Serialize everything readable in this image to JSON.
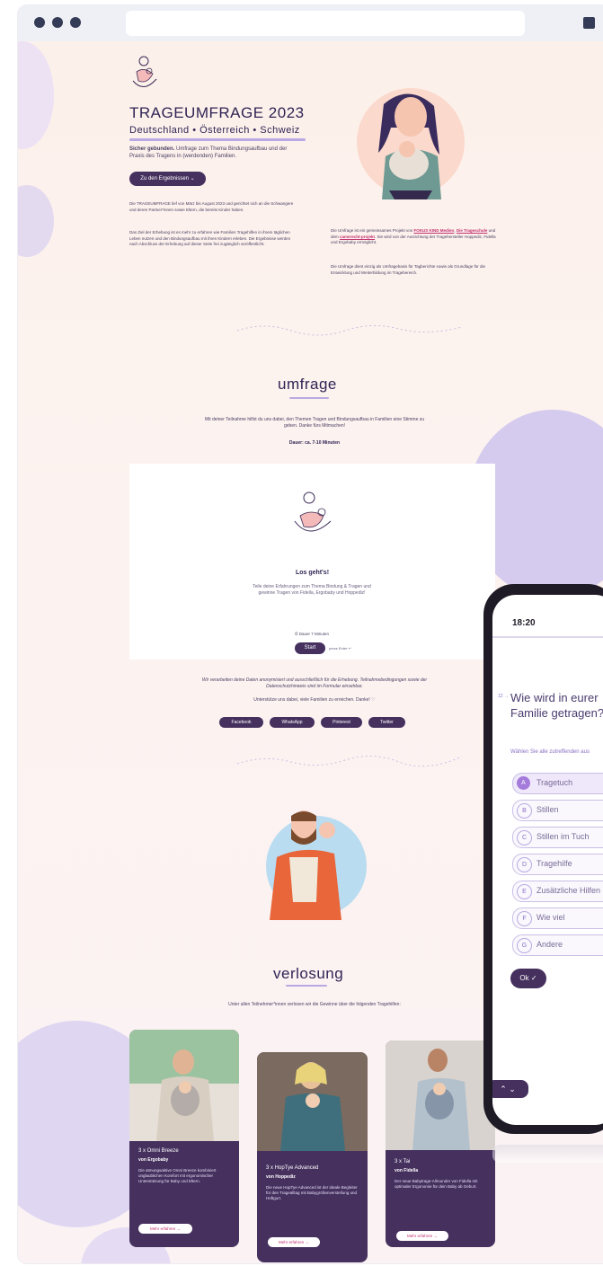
{
  "hero": {
    "title": "TRAGEUMFRAGE 2023",
    "subtitle": "Deutschland • Österreich • Schweiz",
    "intro_bold": "Sicher gebunden.",
    "intro_rest": "Umfrage zum Thema Bindungsaufbau und der Praxis des Tragens in (werdenden) Familien.",
    "results_button": "Zu den Ergebnissen ⌄",
    "col1_p1": "Die TRAGEUMFRAGE lief von März bis August 2023 und gerichtet sich an die Schwangere und deren Partner*innen sowie Eltern, die bereits Kinder haben.",
    "col1_p2": "Das Ziel der Erhebung ist es mehr zu erfahren wie Familien Tragehilfen in ihrem täglichen Leben nutzen und den Bindungsaufbau mit ihren Kindern erleben. Die Ergebnisse werden nach Abschluss der Erhebung auf dieser Seite frei zugänglich veröffentlicht.",
    "col2_p1_a": "Die Umfrage ist ein gemeinsames Projekt von ",
    "col2_link1": "FOKUS KIND Medien",
    "col2_p1_b": ", ",
    "col2_link2": "Die Trageschule",
    "col2_p1_c": " und dem ",
    "col2_link3": "camerecht-projekt",
    "col2_p1_d": ". Sie wird von der Ausrichtung der Tragehersteller Hoppediz, Fidella und Ergobaby ermöglicht.",
    "col2_p2": "Die Umfrage dient einzig als Umfragebasis für Tagberichte sowie als Grundlage für die Entwicklung und Weiterbildung im Tragebereich."
  },
  "survey": {
    "heading": "umfrage",
    "desc": "Mit deiner Teilnahme hilfst du uns dabei, den Themen Tragen und Bindungsaufbau in Familien eine Stimme zu geben. Danke fürs Mitmachen!",
    "duration": "Dauer: ca. 7-10 Minuten",
    "card_title": "Los geht's!",
    "card_text": "Teile deine Erfahrungen zum Thema Bindung & Tragen und gewinne Tragen von Fidella, Ergobaby und Hoppediz!",
    "card_time": "⏱ Dauer 7 Minuten",
    "start_label": "Start",
    "start_hint": "press Enter ↵",
    "privacy": "Wir verarbeiten deine Daten anonymisiert und ausschließlich für die Erhebung. Teilnahmebedingungen sowie der Datenschutzhinweis sind im Formular einsehbar.",
    "support": "Unterstütze uns dabei, viele Familien zu erreichen. Danke! ♡",
    "share": [
      "Facebook",
      "WhatsApp",
      "Pinterest",
      "Twitter"
    ]
  },
  "raffle": {
    "heading": "verlosung",
    "desc": "Unter allen Teilnehmer*innen verlosen wir die Gewinne über die folgenden Tragehilfen:",
    "prizes": [
      {
        "title": "3 x Omni Breeze",
        "brand": "von Ergobaby",
        "desc": "Die atmungsaktive Omni Breeze kombiniert unglaublichen Komfort mit ergonomischer Unterstützung für Baby und Eltern.",
        "btn": "Mehr erfahren →"
      },
      {
        "title": "3 x HopTye Advanced",
        "brand": "von Hoppediz",
        "desc": "Die neue HopTye Advanced ist der ideale Begleiter für den Tragealltag mit Babygrößenverstellung und Hüftgurt.",
        "btn": "Mehr erfahren →"
      },
      {
        "title": "3 x Tai",
        "brand": "von Fidella",
        "desc": "Der neue Babytrage-Allrounder von Fidella mit optimaler Ergonomie für dein Baby ab Geburt.",
        "btn": "Mehr erfahren →"
      }
    ]
  },
  "phone": {
    "time": "18:20",
    "question": "Wie wird in eurer Familie getragen?",
    "hint": "Wählen Sie alle zutreffenden aus",
    "options": [
      {
        "key": "A",
        "label": "Tragetuch"
      },
      {
        "key": "B",
        "label": "Stillen"
      },
      {
        "key": "C",
        "label": "Stillen im Tuch"
      },
      {
        "key": "D",
        "label": "Tragehilfe"
      },
      {
        "key": "E",
        "label": "Zusätzliche Hilfen"
      },
      {
        "key": "F",
        "label": "Wie viel"
      },
      {
        "key": "G",
        "label": "Andere"
      }
    ],
    "ok_label": "Ok ✓",
    "number": "12 →"
  },
  "colors": {
    "primary": "#45305e",
    "accent_pink": "#c2306f",
    "lavender": "#b9a9e2",
    "background": "#fdf1ec"
  }
}
